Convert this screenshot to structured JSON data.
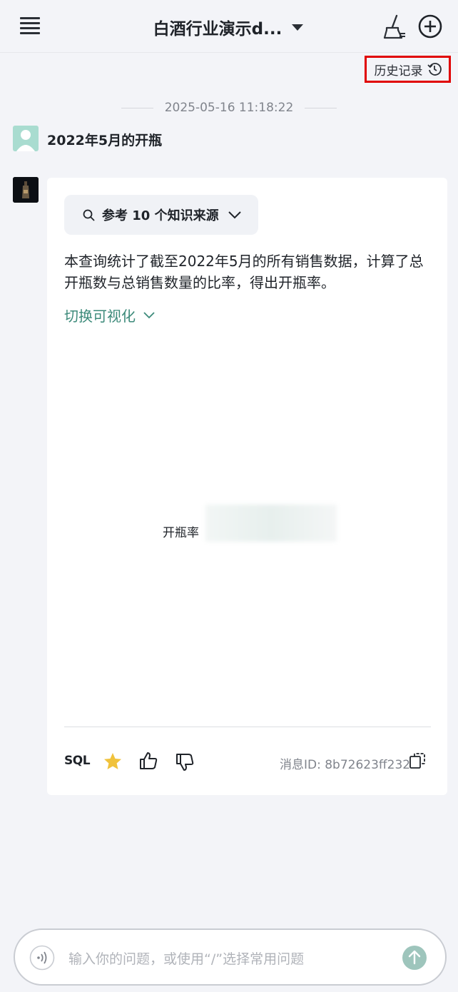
{
  "header": {
    "title": "白酒行业演示d...",
    "icons": [
      "menu-icon",
      "chevron-down-icon",
      "broom-icon",
      "plus-circle-icon"
    ]
  },
  "history": {
    "label": "历史记录",
    "icon": "history-clock-icon",
    "highlight_color": "#e00000"
  },
  "conversation": {
    "timestamp": "2025-05-16 11:18:22",
    "user_question": "2022年5月的开瓶",
    "answer": {
      "sources_label": "参考 10 个知识来源",
      "text": "本查询统计了截至2022年5月的所有销售数据，计算了总开瓶数与总销售数量的比率，得出开瓶率。",
      "toggle_label": "切换可视化",
      "metric_label": "开瓶率",
      "sql_label": "SQL",
      "message_id": "消息ID: 8b72623ff232",
      "accent_color": "#3c8a7a",
      "star_color": "#f0c23c"
    }
  },
  "input": {
    "placeholder": "输入你的问题，或使用“/”选择常用问题"
  }
}
